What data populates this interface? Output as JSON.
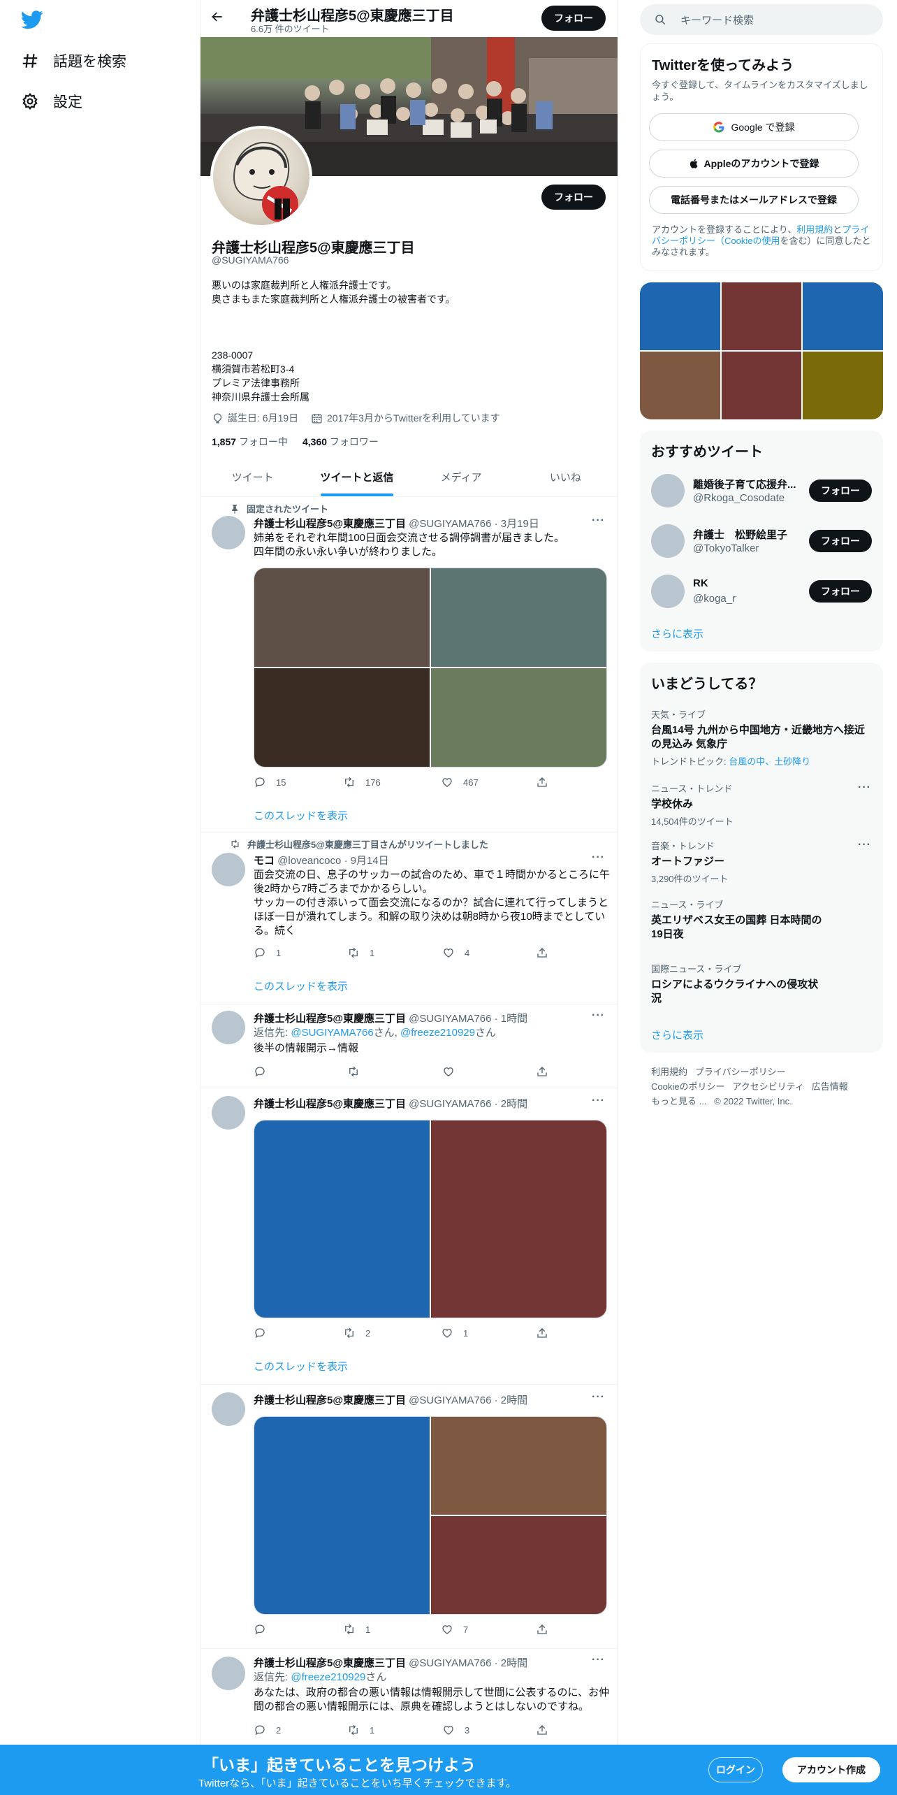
{
  "nav": {
    "explore_label": "話題を検索",
    "settings_label": "設定"
  },
  "header": {
    "name": "弁護士杉山程彦5@東慶應三丁目",
    "tweet_count": "6.6万 件のツイート",
    "follow_label": "フォロー"
  },
  "profile": {
    "name": "弁護士杉山程彦5@東慶應三丁目",
    "handle": "@SUGIYAMA766",
    "bio": "悪いのは家庭裁判所と人権派弁護士です。\n奥さまもまた家庭裁判所と人権派弁護士の被害者です。\n\n\n\n238-0007\n横須賀市若松町3-4\nプレミア法律事務所\n神奈川県弁護士会所属",
    "birthday": "誕生日: 6月19日",
    "joined": "2017年3月からTwitterを利用しています",
    "following_count": "1,857",
    "following_label": "フォロー中",
    "followers_count": "4,360",
    "followers_label": "フォロワー",
    "follow_label": "フォロー"
  },
  "tabs": [
    "ツイート",
    "ツイートと返信",
    "メディア",
    "いいね"
  ],
  "tweets": [
    {
      "context": "固定されたツイート",
      "name": "弁護士杉山程彦5@東慶應三丁目",
      "meta": "@SUGIYAMA766 · 3月19日",
      "text": "姉弟をそれぞれ年間100日面会交流させる調停調書が届きました。\n四年間の永い永い争いが終わりました。",
      "replies": "15",
      "retweets": "176",
      "likes": "467",
      "media_colors": [
        "#5e5047",
        "#5c7472",
        "#3a2c22",
        "#6a7c5c"
      ],
      "show_thread": "このスレッドを表示"
    },
    {
      "context": "弁護士杉山程彦5@東慶應三丁目さんがリツイートしました",
      "name": "モコ",
      "meta": "@loveancoco · 9月14日",
      "text": "面会交流の日、息子のサッカーの試合のため、車で１時間かかるところに午後2時から7時ごろまでかかるらしい。\nサッカーの付き添いって面会交流になるのか？試合に連れて行ってしまうとほぼ一日が潰れてしまう。和解の取り決めは朝8時から夜10時までとしている。続く",
      "replies": "1",
      "retweets": "1",
      "likes": "4",
      "show_thread": "このスレッドを表示"
    },
    {
      "name": "弁護士杉山程彦5@東慶應三丁目",
      "meta": "@SUGIYAMA766 · 1時間",
      "reply_prefix": "返信先: ",
      "reply_to_1": "@SUGIYAMA766",
      "reply_mid": "さん, ",
      "reply_to_2": "@freeze210929",
      "reply_suffix": "さん",
      "text": "後半の情報開示→情報"
    },
    {
      "name": "弁護士杉山程彦5@東慶應三丁目",
      "meta": "@SUGIYAMA766 · 2時間",
      "retweets": "2",
      "likes": "1",
      "media_colors": [
        "#1f66b0",
        "#743535"
      ],
      "show_thread": "このスレッドを表示"
    },
    {
      "name": "弁護士杉山程彦5@東慶應三丁目",
      "meta": "@SUGIYAMA766 · 2時間",
      "retweets": "1",
      "likes": "7",
      "media_colors": [
        "#1f66b0",
        "#7e5840",
        "#743535"
      ]
    },
    {
      "name": "弁護士杉山程彦5@東慶應三丁目",
      "meta": "@SUGIYAMA766 · 2時間",
      "reply_prefix": "返信先: ",
      "reply_to_1": "@freeze210929",
      "reply_suffix": "さん",
      "text": "あなたは、政府の都合の悪い情報は情報開示して世間に公表するのに、お仲間の都合の悪い情報開示には、原典を確認しようとはしないのですね。",
      "replies": "2",
      "retweets": "1",
      "likes": "3"
    }
  ],
  "search": {
    "placeholder": "キーワード検索"
  },
  "signup": {
    "title": "Twitterを使ってみよう",
    "subtitle": "今すぐ登録して、タイムラインをカスタマイズしましょう。",
    "google": "Google で登録",
    "apple": "Appleのアカウントで登録",
    "phone": "電話番号またはメールアドレスで登録",
    "legal_1": "アカウントを登録することにより、",
    "legal_terms": "利用規約",
    "legal_and": "と",
    "legal_privacy": "プライバシーポリシー",
    "legal_cookie": "（Cookieの使用",
    "legal_2": "を含む）に同意したとみなされます。"
  },
  "media_grid_colors": [
    "#1f66b0",
    "#743535",
    "#1f66b0",
    "#7e5840",
    "#743535",
    "#7a6a0a"
  ],
  "recommended": {
    "title": "おすすめツイート",
    "items": [
      {
        "name": "離婚後子育て応援弁...",
        "handle": "@Rkoga_Cosodate",
        "button": "フォロー"
      },
      {
        "name": "弁護士　松野絵里子",
        "handle": "@TokyoTalker",
        "button": "フォロー"
      },
      {
        "name": "RK",
        "handle": "@koga_r",
        "button": "フォロー"
      }
    ],
    "more": "さらに表示"
  },
  "trends": {
    "title": "いまどうしてる？",
    "items": [
      {
        "category": "天気・ライブ",
        "title": "台風14号 九州から中国地方・近畿地方へ接近の見込み 気象庁",
        "sub_prefix": "トレンドトピック: ",
        "sub_link": "台風の中、土砂降り"
      },
      {
        "category": "ニュース・トレンド",
        "title": "学校休み",
        "sub": "14,504件のツイート"
      },
      {
        "category": "音楽・トレンド",
        "title": "オートファジー",
        "sub": "3,290件のツイート"
      },
      {
        "category": "ニュース・ライブ",
        "title": "英エリザベス女王の国葬 日本時間の19日夜"
      },
      {
        "category": "国際ニュース・ライブ",
        "title": "ロシアによるウクライナへの侵攻状況"
      }
    ],
    "more": "さらに表示"
  },
  "footer": {
    "terms": "利用規約",
    "privacy": "プライバシーポリシー",
    "cookie": "Cookieのポリシー",
    "accessibility": "アクセシビリティ",
    "ads": "広告情報",
    "more": "もっと見る ...",
    "copyright": "© 2022 Twitter, Inc."
  },
  "bottom_bar": {
    "title": "「いま」起きていることを見つけよう",
    "subtitle": "Twitterなら、「いま」起きていることをいち早くチェックできます。",
    "login": "ログイン",
    "signup": "アカウント作成"
  },
  "colors": {
    "accent": "#1d9bf0",
    "text": "#0f1419",
    "muted": "#536471"
  }
}
